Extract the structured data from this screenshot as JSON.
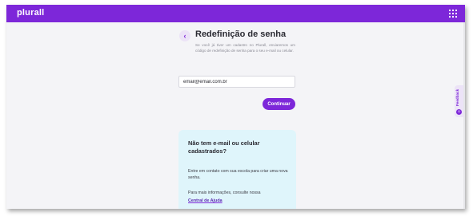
{
  "header": {
    "logo_text": "plurall",
    "apps_icon": "grid-icon",
    "brand_color": "#7d27d9"
  },
  "reset": {
    "back_icon": "chevron-left-icon",
    "title": "Redefinição de senha",
    "description": "Se você já tiver um cadastro no Plurall, enviaremos um código de redefinição de senha para o seu e-mail ou celular.",
    "email_value": "email@email.com.br",
    "continue_label": "Continuar"
  },
  "help": {
    "title": "Não tem e-mail ou celular cadastrados?",
    "text": "Entre em contato com sua escola para criar uma nova senha.",
    "more_info": "Para mais informações, consulte nossa",
    "link_label": "Central de Ajuda"
  },
  "feedback": {
    "label": "Feedback",
    "icon": "smile-icon"
  }
}
